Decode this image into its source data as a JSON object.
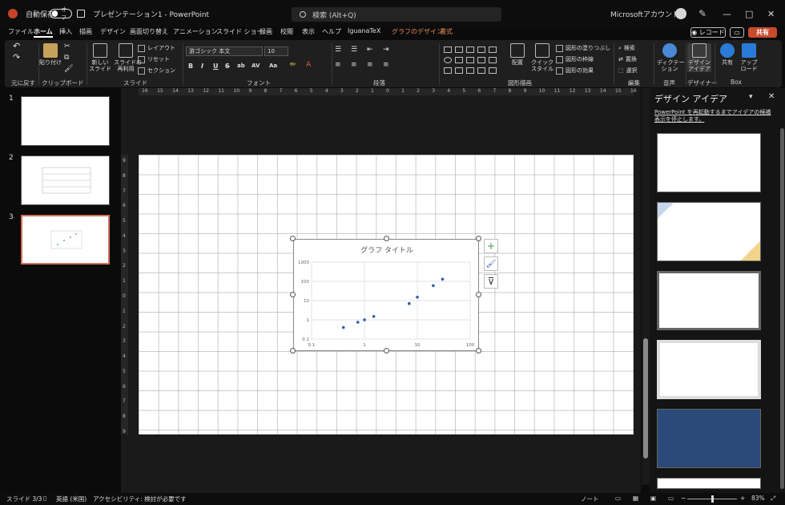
{
  "titlebar": {
    "autosave_label": "自動保存",
    "autosave_state": "オフ",
    "doc_title": "プレゼンテーション1 - PowerPoint",
    "search_placeholder": "検索 (Alt+Q)",
    "account_name": "Microsoftアカウント名",
    "min_glyph": "—",
    "max_glyph": "□",
    "close_glyph": "✕"
  },
  "menu": {
    "tabs": [
      "ファイル",
      "ホーム",
      "挿入",
      "描画",
      "デザイン",
      "画面切り替え",
      "アニメーション",
      "スライド ショー",
      "録画",
      "校閲",
      "表示",
      "ヘルプ",
      "IguanaTeX",
      "グラフのデザイン",
      "書式"
    ],
    "active_index": 1,
    "record_label": "◉ レコード",
    "share_label": "共有"
  },
  "ribbon": {
    "groups": {
      "undo": "元に戻す",
      "clipboard": "クリップボード",
      "slides": "スライド",
      "font": "フォント",
      "paragraph": "段落",
      "drawing": "図形描画",
      "editing": "編集",
      "voice": "音声",
      "designer": "デザイナー",
      "box": "Box"
    },
    "paste": "貼り付け",
    "new_slide": "新しい\nスライド",
    "reuse_slide": "スライドの\n再利用",
    "layout": "レイアウト",
    "reset": "リセット",
    "section": "セクション",
    "font_name": "游ゴシック 本文",
    "font_size": "10",
    "format_buttons": [
      "B",
      "I",
      "U",
      "S",
      "ab",
      "AV",
      "Aa"
    ],
    "arrange": "配置",
    "quick_style": "クイック\nスタイル",
    "shape_fill": "図形の塗りつぶし",
    "shape_outline": "図形の枠線",
    "shape_effect": "図形の効果",
    "find": "検索",
    "replace": "置換",
    "select": "選択",
    "dictate": "ディクテー\nション",
    "designer_btn": "デザイン\nアイデア",
    "share_btn": "共有",
    "upload_btn": "アップ\nロード"
  },
  "thumbnails": [
    "1",
    "2",
    "3"
  ],
  "ruler": {
    "h_ticks": [
      "16",
      "15",
      "14",
      "13",
      "12",
      "11",
      "10",
      "9",
      "8",
      "7",
      "6",
      "5",
      "4",
      "3",
      "2",
      "1",
      "0",
      "1",
      "2",
      "3",
      "4",
      "5",
      "6",
      "7",
      "8",
      "9",
      "10",
      "11",
      "12",
      "13",
      "14",
      "15",
      "16"
    ],
    "v_ticks": [
      "9",
      "8",
      "7",
      "6",
      "5",
      "4",
      "3",
      "2",
      "1",
      "0",
      "1",
      "2",
      "3",
      "4",
      "5",
      "6",
      "7",
      "8",
      "9"
    ]
  },
  "chart_data": {
    "type": "scatter",
    "title": "グラフ タイトル",
    "x_scale": "log",
    "y_scale": "log",
    "xlim": [
      0.1,
      100
    ],
    "ylim": [
      0.1,
      1000
    ],
    "x_ticks": [
      "0.1",
      "1",
      "10",
      "100"
    ],
    "y_ticks": [
      "1000",
      "100",
      "10",
      "1",
      "0.1"
    ],
    "grid": true,
    "color": "#2e5ca8",
    "points": [
      {
        "x": 0.4,
        "y": 0.4
      },
      {
        "x": 0.75,
        "y": 0.75
      },
      {
        "x": 1.0,
        "y": 1.0
      },
      {
        "x": 1.5,
        "y": 1.5
      },
      {
        "x": 7,
        "y": 7
      },
      {
        "x": 10,
        "y": 15
      },
      {
        "x": 20,
        "y": 60
      },
      {
        "x": 30,
        "y": 130
      }
    ]
  },
  "chart_tools": {
    "add_element": "+",
    "styles": "🖌",
    "filter": "⊽"
  },
  "design_pane": {
    "title": "デザイン アイデア",
    "collapse": "▾",
    "close": "✕",
    "note": "PowerPoint を再起動するまでアイデアの候補表示を停止します。"
  },
  "statusbar": {
    "slide_pos": "スライド 3/3",
    "language": "英語 (米国)",
    "accessibility": "アクセシビリティ: 検討が必要です",
    "notes": "ノート",
    "zoom": "83%"
  }
}
